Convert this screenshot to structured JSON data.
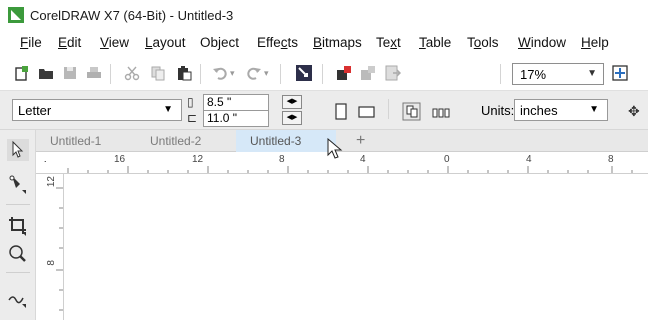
{
  "window": {
    "title_app": "CorelDRAW X7 (64-Bit)",
    "title_sep": " - ",
    "title_doc": "Untitled-3"
  },
  "menu": {
    "items": [
      {
        "pre": "",
        "u": "F",
        "post": "ile"
      },
      {
        "pre": "",
        "u": "E",
        "post": "dit"
      },
      {
        "pre": "",
        "u": "V",
        "post": "iew"
      },
      {
        "pre": "",
        "u": "L",
        "post": "ayout"
      },
      {
        "pre": "Ob",
        "u": "j",
        "post": "ect"
      },
      {
        "pre": "Effe",
        "u": "c",
        "post": "ts"
      },
      {
        "pre": "",
        "u": "B",
        "post": "itmaps"
      },
      {
        "pre": "Te",
        "u": "x",
        "post": "t"
      },
      {
        "pre": "",
        "u": "T",
        "post": "able"
      },
      {
        "pre": "T",
        "u": "o",
        "post": "ols"
      },
      {
        "pre": "",
        "u": "W",
        "post": "indow"
      },
      {
        "pre": "",
        "u": "H",
        "post": "elp"
      }
    ]
  },
  "toolbar": {
    "zoom_value": "17%",
    "icons": [
      "new-document-icon",
      "open-folder-icon",
      "save-icon",
      "print-icon",
      "cut-icon",
      "copy-icon",
      "paste-icon",
      "undo-icon",
      "redo-icon",
      "search-content-icon",
      "import-icon",
      "export-icon",
      "publish-pdf-icon",
      "zoom-fit-icon"
    ]
  },
  "propbar": {
    "page_size": "Letter",
    "width": "8.5 \"",
    "height": "11.0 \"",
    "units_label": "Units:",
    "units_value": "inches"
  },
  "tabs": [
    {
      "label": "Untitled-1",
      "active": false
    },
    {
      "label": "Untitled-2",
      "active": false
    },
    {
      "label": "Untitled-3",
      "active": true
    }
  ],
  "tab_add_label": "+",
  "ruler": {
    "h_labels": [
      "16",
      "12",
      "8",
      "4",
      "0",
      "4",
      "8"
    ],
    "v_labels": [
      "12",
      "8"
    ]
  },
  "colors": {
    "app_logo": "#3c9a3c",
    "active_tab": "#d6e8f8",
    "propbar_bg": "#ececec"
  }
}
